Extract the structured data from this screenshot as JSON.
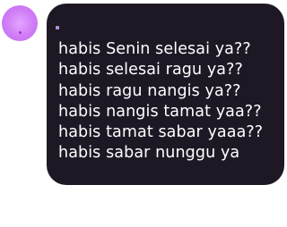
{
  "message": {
    "lines": [
      "habis Senin selesai ya??",
      "habis selesai ragu ya??",
      "habis ragu nangis ya??",
      "habis nangis tamat yaa??",
      "habis tamat sabar yaaa??",
      "habis sabar nunggu ya"
    ]
  },
  "colors": {
    "bubble_background": "#1e1825",
    "text": "#ffffff",
    "avatar": "#cf7cf5"
  }
}
